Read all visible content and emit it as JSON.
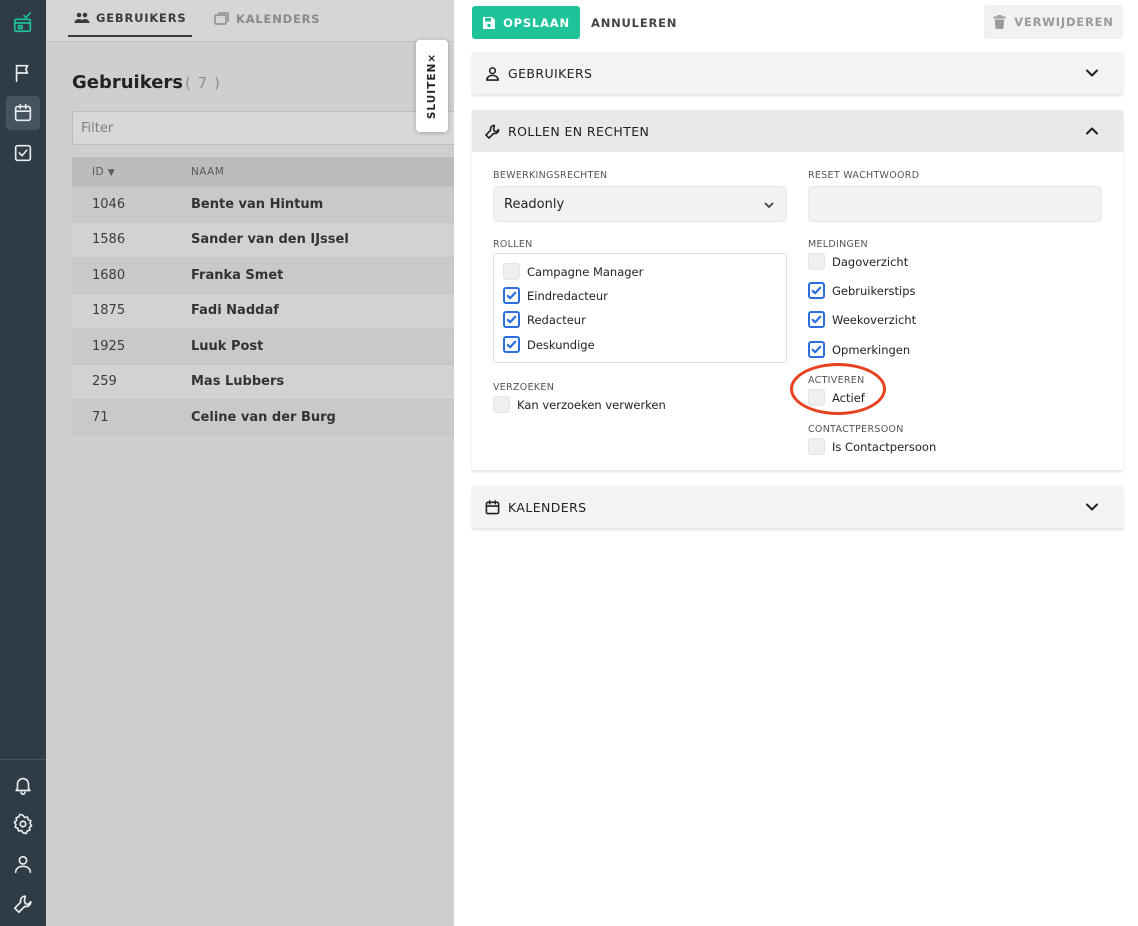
{
  "nav": {
    "tab_users": "GEBRUIKERS",
    "tab_calendars": "KALENDERS"
  },
  "list": {
    "title": "Gebruikers",
    "count": "( 7 )",
    "filter_placeholder": "Filter",
    "col_id": "ID",
    "col_name": "NAAM",
    "rows": [
      {
        "id": "1046",
        "name": "Bente van Hintum"
      },
      {
        "id": "1586",
        "name": "Sander van den IJssel"
      },
      {
        "id": "1680",
        "name": "Franka Smet"
      },
      {
        "id": "1875",
        "name": "Fadi Naddaf"
      },
      {
        "id": "1925",
        "name": "Luuk Post"
      },
      {
        "id": "259",
        "name": "Mas Lubbers"
      },
      {
        "id": "71",
        "name": "Celine van der Burg"
      }
    ]
  },
  "close_tab": "SLUITEN",
  "close_glyph": "×",
  "toolbar": {
    "save": "OPSLAAN",
    "cancel": "ANNULEREN",
    "delete": "VERWIJDEREN"
  },
  "sections": {
    "users": "GEBRUIKERS",
    "roles": "ROLLEN EN RECHTEN",
    "calendars": "KALENDERS"
  },
  "form": {
    "edit_rights_label": "BEWERKINGSRECHTEN",
    "edit_rights_value": "Readonly",
    "reset_pw_label": "RESET WACHTWOORD",
    "roles_label": "ROLLEN",
    "roles": [
      {
        "label": "Campagne Manager",
        "checked": false
      },
      {
        "label": "Eindredacteur",
        "checked": true
      },
      {
        "label": "Redacteur",
        "checked": true
      },
      {
        "label": "Deskundige",
        "checked": true
      }
    ],
    "requests_label": "VERZOEKEN",
    "requests_option": "Kan verzoeken verwerken",
    "notifications_label": "MELDINGEN",
    "notifications": [
      {
        "label": "Dagoverzicht",
        "checked": false
      },
      {
        "label": "Gebruikerstips",
        "checked": true
      },
      {
        "label": "Weekoverzicht",
        "checked": true
      },
      {
        "label": "Opmerkingen",
        "checked": true
      }
    ],
    "activate_label": "ACTIVEREN",
    "activate_option": "Actief",
    "contact_label": "CONTACTPERSOON",
    "contact_option": "Is Contactpersoon"
  },
  "colors": {
    "accent": "#1fc39a",
    "checkbox": "#2a6ee0",
    "annotation": "#e8411f",
    "rail": "#2f3b45"
  }
}
